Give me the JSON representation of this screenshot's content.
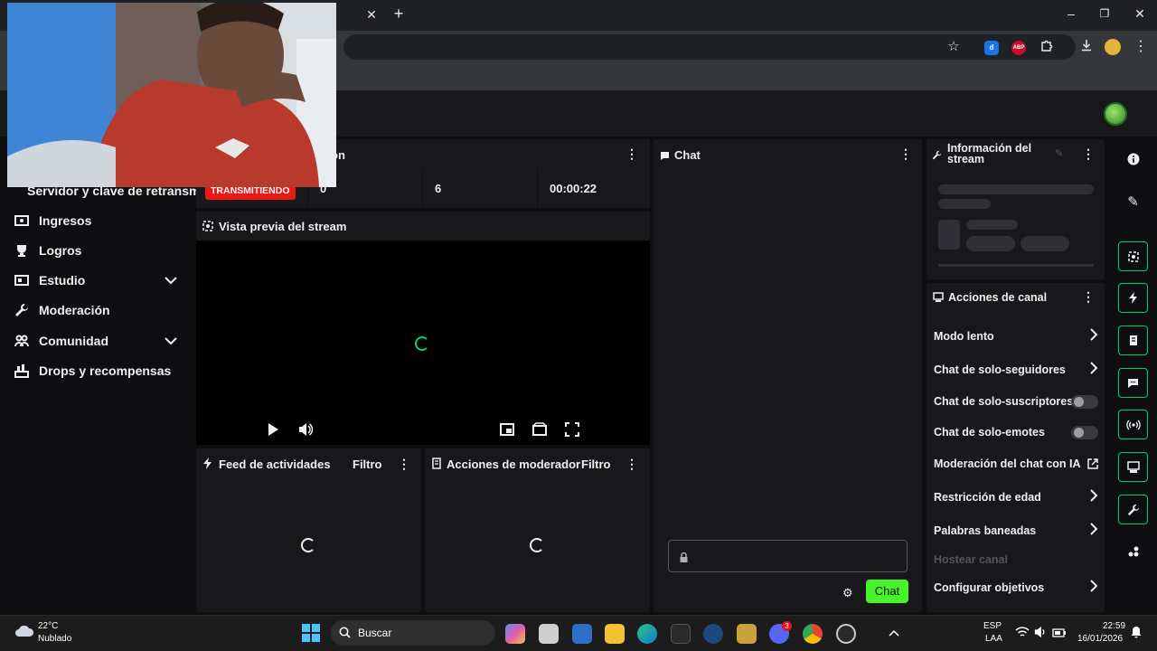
{
  "colors": {
    "accent_green": "#00d26a",
    "live_red": "#e91916",
    "chat_button": "#45f52a",
    "panel_bg": "#18181b",
    "page_bg": "#0e0e10"
  },
  "sidebar": {
    "partial_item": "Servidor y clave de retransm",
    "items": [
      {
        "label": "Ingresos",
        "icon": "money-icon",
        "expandable": false
      },
      {
        "label": "Logros",
        "icon": "trophy-icon",
        "expandable": false
      },
      {
        "label": "Estudio",
        "icon": "studio-icon",
        "expandable": true
      },
      {
        "label": "Moderación",
        "icon": "wrench-icon",
        "expandable": false
      },
      {
        "label": "Comunidad",
        "icon": "people-icon",
        "expandable": true
      },
      {
        "label": "Drops y recompensas",
        "icon": "gift-icon",
        "expandable": false
      }
    ]
  },
  "session": {
    "title_partial": "on",
    "status_badge": "TRANSMITIENDO",
    "stat1": "0",
    "stat2": "6",
    "duration": "00:00:22"
  },
  "preview": {
    "title": "Vista previa del stream"
  },
  "feed": {
    "title": "Feed de actividades",
    "filter": "Filtro"
  },
  "mod_actions": {
    "title": "Acciones de moderador",
    "filter": "Filtro"
  },
  "chat": {
    "title": "Chat",
    "send_label": "Chat"
  },
  "stream_info": {
    "title": "Información del stream"
  },
  "channel_actions": {
    "title": "Acciones de canal",
    "items": [
      {
        "label": "Modo lento",
        "control": "arrow"
      },
      {
        "label": "Chat de solo-seguidores",
        "control": "arrow"
      },
      {
        "label": "Chat de solo-suscriptores",
        "control": "toggle"
      },
      {
        "label": "Chat de solo-emotes",
        "control": "toggle"
      },
      {
        "label": "Moderación del chat con IA",
        "control": "external"
      },
      {
        "label": "Restricción de edad",
        "control": "arrow"
      },
      {
        "label": "Palabras baneadas",
        "control": "arrow"
      },
      {
        "label": "Hostear canal",
        "control": "disabled"
      },
      {
        "label": "Configurar objetivos",
        "control": "arrow"
      }
    ]
  },
  "browser": {
    "extensions": [
      "d",
      "ABP"
    ]
  },
  "taskbar": {
    "weather_temp": "22°C",
    "weather_desc": "Nublado",
    "search_placeholder": "Buscar",
    "lang_1": "ESP",
    "lang_2": "LAA",
    "time": "22:59",
    "date": "16/01/2026",
    "discord_badge": "3"
  }
}
